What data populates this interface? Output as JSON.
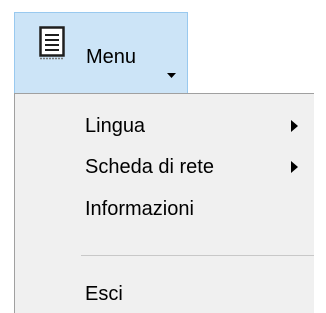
{
  "menu_button": {
    "label": "Menu",
    "icon": "document-lines-icon",
    "dropdown_icon": "dropdown-arrow-icon"
  },
  "menu": {
    "items": [
      {
        "label": "Lingua",
        "has_submenu": true
      },
      {
        "label": "Scheda di rete",
        "has_submenu": true
      },
      {
        "label": "Informazioni",
        "has_submenu": false
      },
      {
        "label": "Esci",
        "has_submenu": false
      }
    ]
  },
  "colors": {
    "button_hover_bg": "#cce4f7",
    "button_hover_border": "#99c9ef",
    "menu_bg": "#f0f0f0",
    "menu_border": "#a0a0a0",
    "separator": "#c8c8c8"
  }
}
